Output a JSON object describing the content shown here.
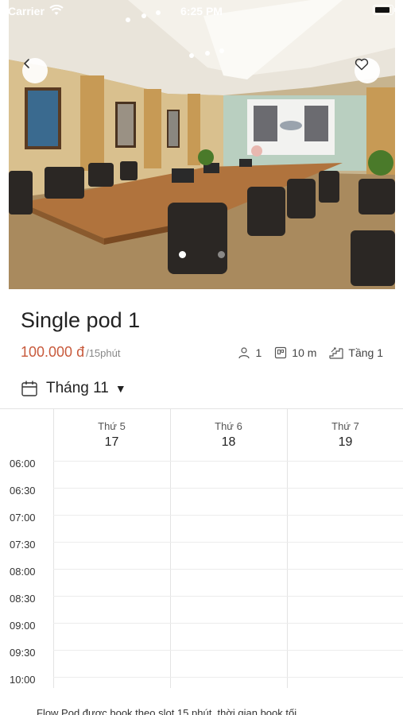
{
  "status_bar": {
    "carrier": "Carrier",
    "time": "6:25 PM"
  },
  "hero": {
    "image_description_icon": "conference-room-photo",
    "page_count": 2,
    "active_page": 1
  },
  "title": "Single pod 1",
  "price": {
    "amount": "100.000 đ",
    "unit": "/15phút"
  },
  "meta": {
    "capacity": "1",
    "area": "10 m",
    "floor": "Tầng 1"
  },
  "month": {
    "label": "Tháng 11"
  },
  "calendar": {
    "days": [
      {
        "name": "Thứ 5",
        "number": "17"
      },
      {
        "name": "Thứ 6",
        "number": "18"
      },
      {
        "name": "Thứ 7",
        "number": "19"
      }
    ],
    "times": [
      "06:00",
      "06:30",
      "07:00",
      "07:30",
      "08:00",
      "08:30",
      "09:00",
      "09:30",
      "10:00"
    ]
  },
  "footer_note": "Flow Pod được book theo slot 15 phút, thời gian book tối"
}
